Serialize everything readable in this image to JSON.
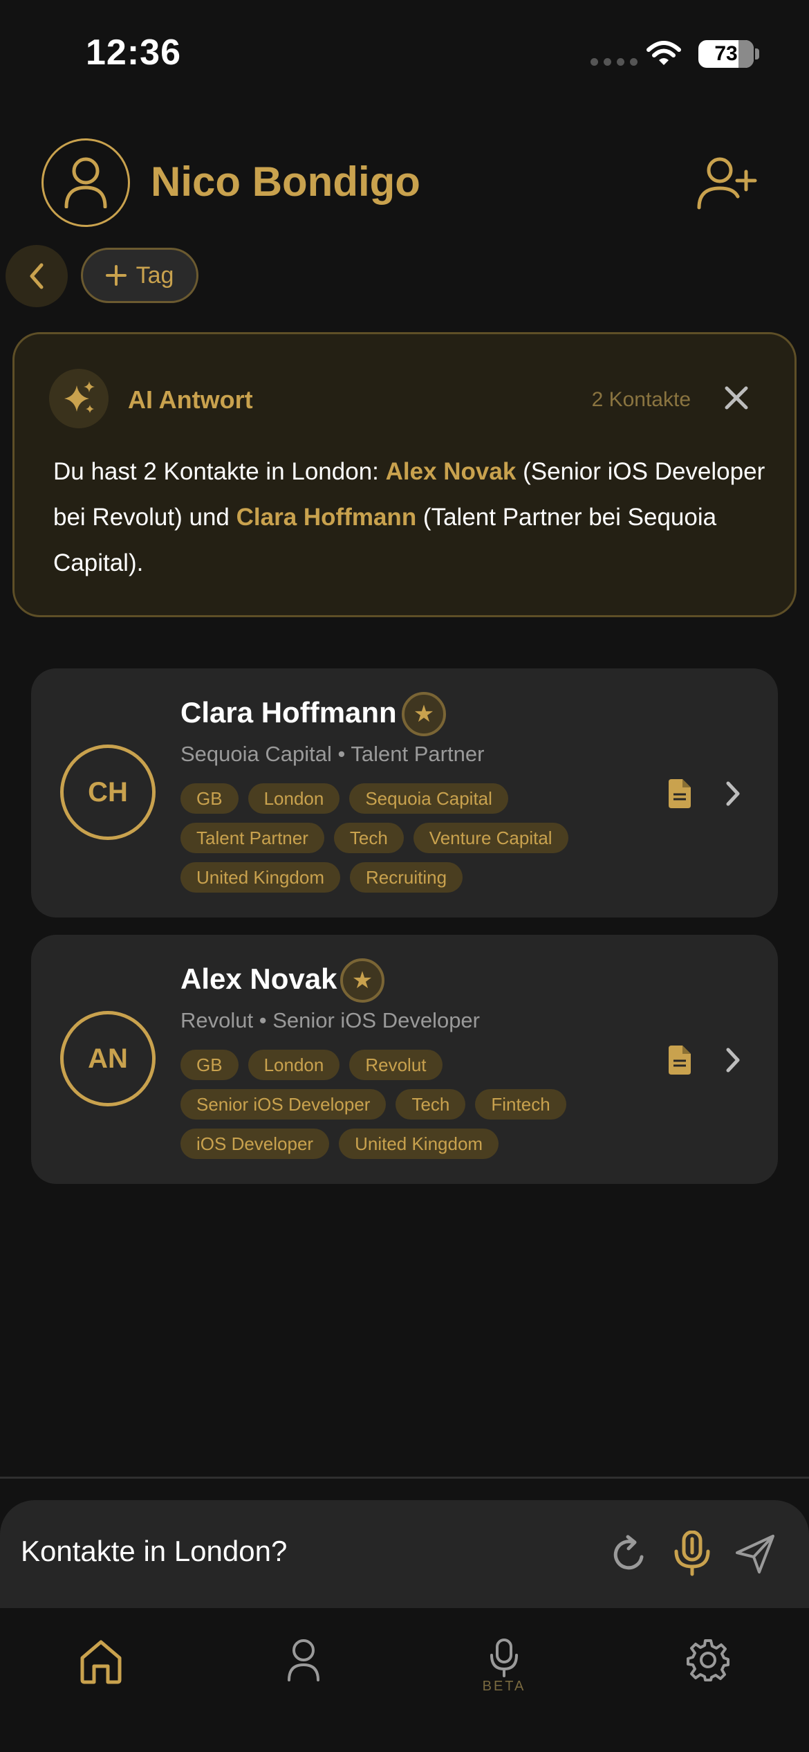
{
  "status_bar": {
    "time": "12:36",
    "battery": "73",
    "battery_level": 0.73
  },
  "header": {
    "user_name": "Nico Bondigo",
    "tag_button_label": "Tag"
  },
  "ai_answer": {
    "title": "AI Antwort",
    "count": "2 Kontakte",
    "text_1": "Du hast 2 Kontakte in London: ",
    "name_1": "Alex Novak",
    "text_2": " (Senior iOS Developer bei Revolut) und ",
    "name_2": "Clara Hoffmann",
    "text_3": " (Talent Partner bei Sequoia Capital)."
  },
  "contacts": [
    {
      "initials": "CH",
      "name": "Clara Hoffmann",
      "subtitle": "Sequoia Capital • Talent Partner",
      "tags": [
        "GB",
        "London",
        "Sequoia Capital",
        "Talent Partner",
        "Tech",
        "Venture Capital",
        "United Kingdom",
        "Recruiting"
      ]
    },
    {
      "initials": "AN",
      "name": "Alex Novak",
      "subtitle": "Revolut • Senior iOS Developer",
      "tags": [
        "GB",
        "London",
        "Revolut",
        "Senior iOS Developer",
        "Tech",
        "Fintech",
        "iOS Developer",
        "United Kingdom"
      ]
    }
  ],
  "input": {
    "value": "Kontakte in London?"
  },
  "tab_bar": {
    "beta_label": "BETA"
  },
  "colors": {
    "accent": "#C9A24E",
    "background": "#121212",
    "card": "#262626"
  },
  "icons": [
    "wifi-icon",
    "person-icon",
    "person-add-icon",
    "chevron-left-icon",
    "plus-icon",
    "sparkles-icon",
    "close-icon",
    "star-icon",
    "document-icon",
    "chevron-right-icon",
    "refresh-icon",
    "microphone-icon",
    "send-icon",
    "home-icon",
    "gear-icon"
  ]
}
